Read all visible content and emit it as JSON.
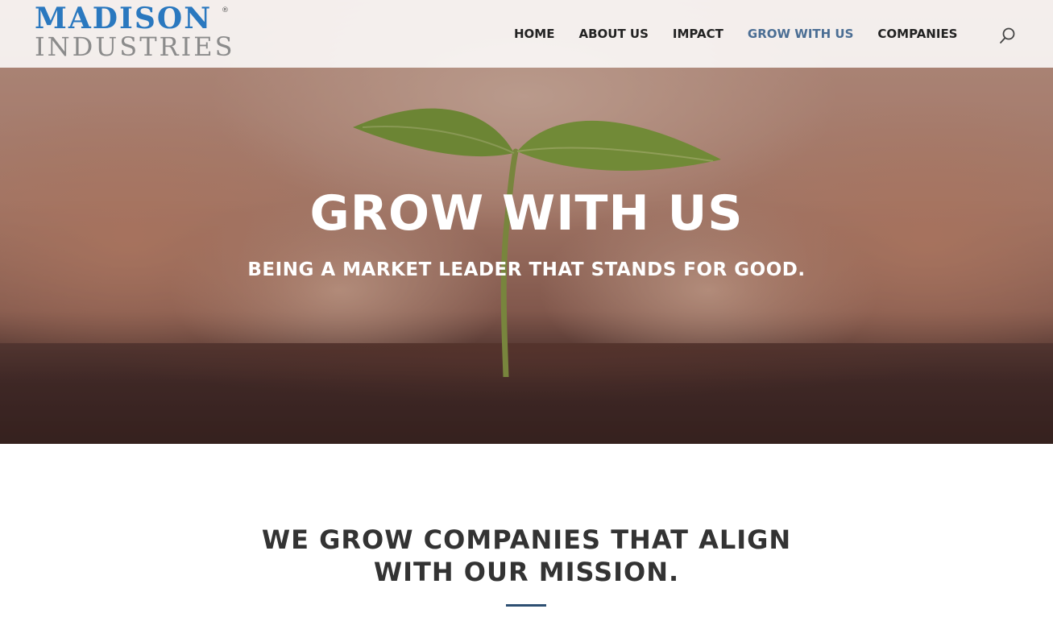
{
  "brand": {
    "line1": "MADISON",
    "registered": "®",
    "line2": "INDUSTRIES",
    "primary_color": "#2a78bf",
    "secondary_color": "#8b8b8b"
  },
  "nav": {
    "items": [
      {
        "label": "HOME",
        "active": false
      },
      {
        "label": "ABOUT US",
        "active": false
      },
      {
        "label": "IMPACT",
        "active": false
      },
      {
        "label": "GROW WITH US",
        "active": true
      },
      {
        "label": "COMPANIES",
        "active": false
      }
    ],
    "active_color": "#4b6e94",
    "search_icon": "search-icon"
  },
  "hero": {
    "title": "GROW WITH US",
    "subtitle": "BEING A MARKET LEADER THAT STANDS FOR GOOD."
  },
  "mission": {
    "line1": "WE GROW COMPANIES THAT ALIGN",
    "line2": "WITH OUR MISSION.",
    "divider_color": "#2d4f72"
  }
}
